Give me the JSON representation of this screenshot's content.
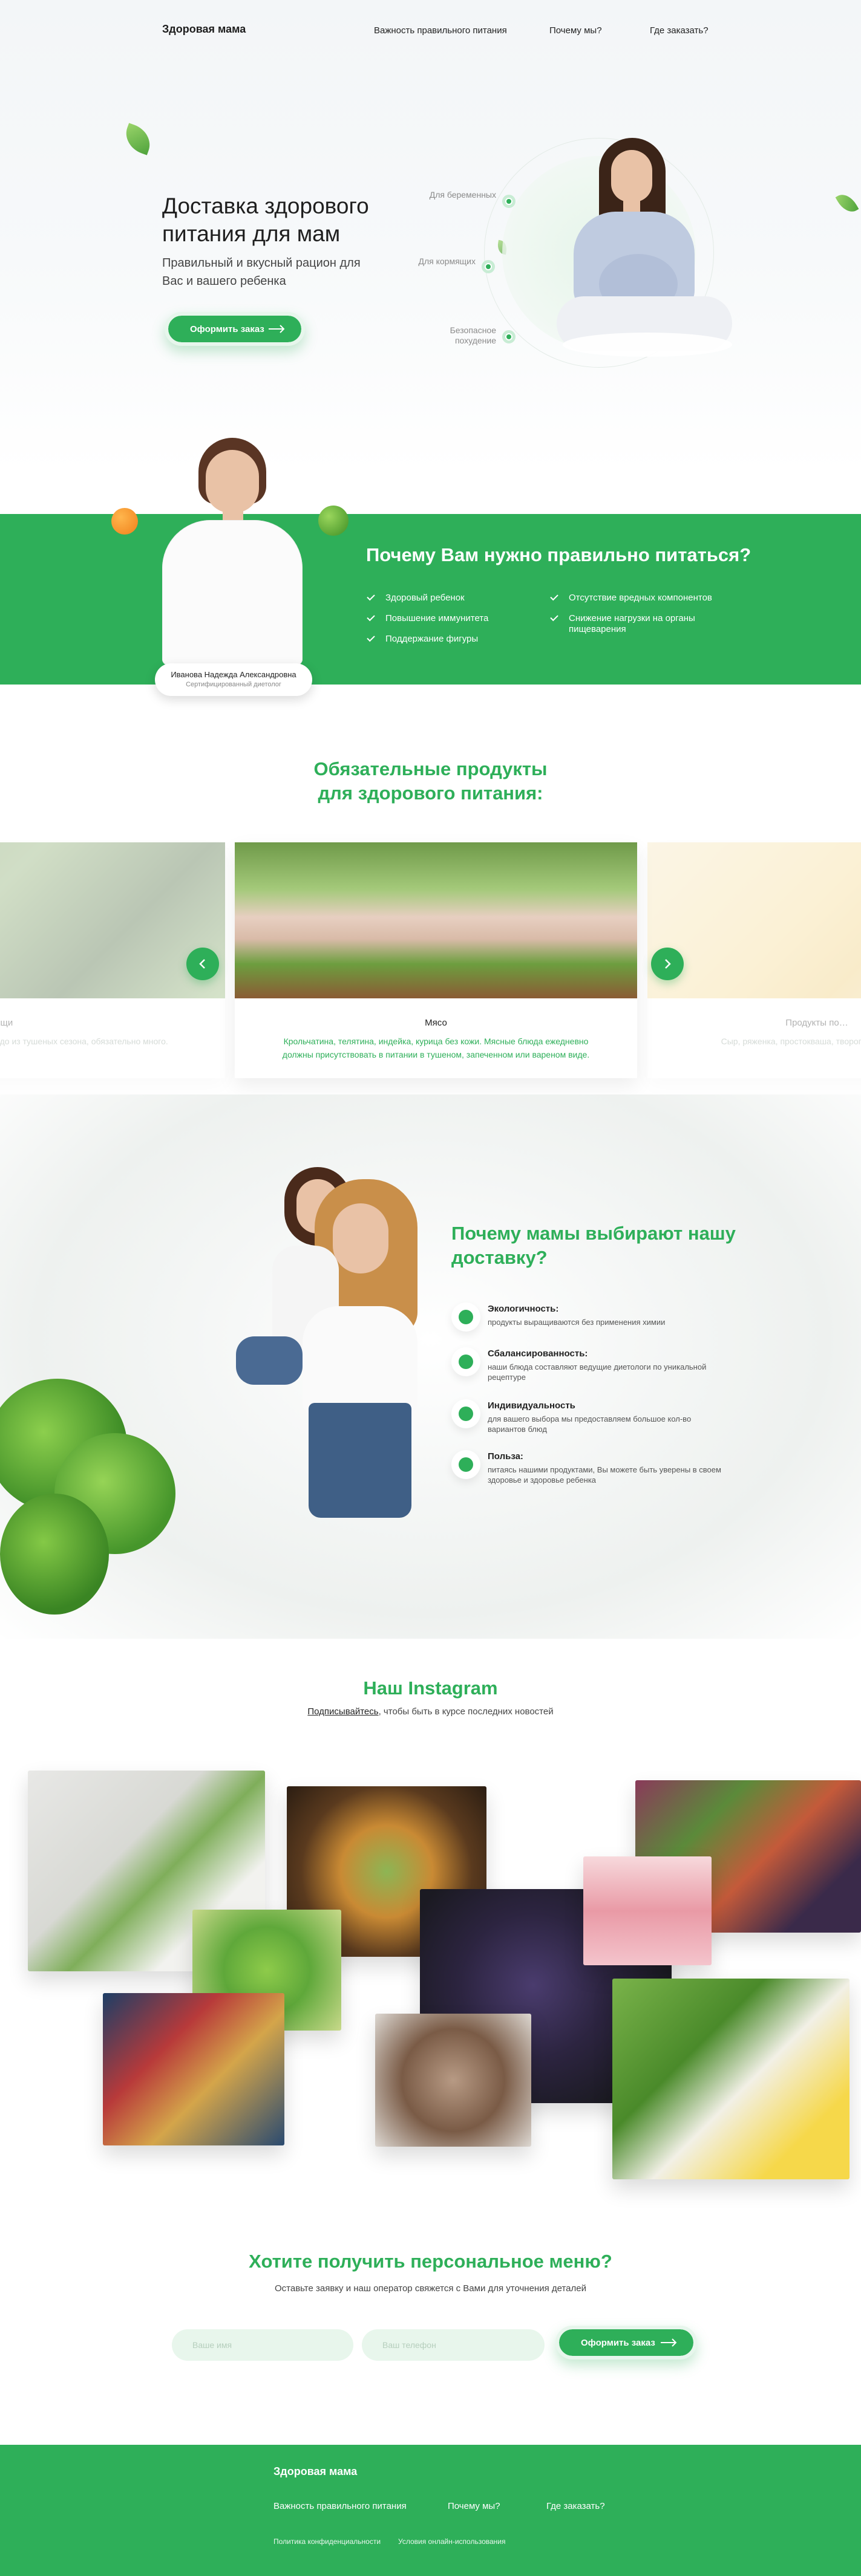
{
  "header": {
    "logo": "Здоровая мама",
    "nav": [
      "Важность правильного питания",
      "Почему мы?",
      "Где заказать?"
    ]
  },
  "hero": {
    "title": "Доставка здорового питания для мам",
    "subtitle": "Правильный и вкусный рацион для Вас и вашего ребенка",
    "button": "Оформить заказ",
    "bullets": [
      "Для беременных",
      "Для кормящих",
      "Безопасное похудение"
    ]
  },
  "why_eat": {
    "title": "Почему Вам нужно правильно питаться?",
    "col1": [
      "Здоровый ребенок",
      "Повышение иммунитета",
      "Поддержание фигуры"
    ],
    "col2": [
      "Отсутствие вредных компонентов",
      "Снижение нагрузки на органы пищеварения"
    ],
    "expert_name": "Иванова Надежда Александровна",
    "expert_role": "Сертифицированный диетолог"
  },
  "products": {
    "title": "Обязательные продукты для здорового питания:",
    "cards": [
      {
        "title": "Овощи",
        "text": "…гурцы, огурцы. Печеное блюдо из тушеных сезона, обязательно много."
      },
      {
        "title": "Мясо",
        "text": "Крольчатина, телятина, индейка, курица без кожи. Мясные блюда ежедневно должны присутствовать в питании в тушеном, запеченном или вареном виде."
      },
      {
        "title": "Продукты по…",
        "text": "Сыр, ряженка, простокваша, творог. Кисломолочные продукты…"
      }
    ]
  },
  "why_us": {
    "title": "Почему мамы выбирают нашу доставку?",
    "features": [
      {
        "title": "Экологичность:",
        "text": "продукты выращиваются без применения химии"
      },
      {
        "title": "Сбалансированность:",
        "text": "наши блюда составляют ведущие диетологи по уникальной рецептуре"
      },
      {
        "title": "Индивидуальность",
        "text": "для вашего выбора мы предоставляем большое кол-во вариантов блюд"
      },
      {
        "title": "Польза:",
        "text": "питаясь нашими продуктами, Вы можете быть уверены в своем здоровье и здоровье ребенка"
      }
    ]
  },
  "instagram": {
    "title": "Наш Instagram",
    "subscribe_link": "Подписывайтесь",
    "subscribe_text": ", чтобы быть в курсе последних новостей"
  },
  "form": {
    "title": "Хотите получить персональное меню?",
    "subtitle": "Оставьте заявку и наш оператор свяжется с Вами для уточнения деталей",
    "name_placeholder": "Ваше имя",
    "phone_placeholder": "Ваш телефон",
    "button": "Оформить заказ"
  },
  "footer": {
    "logo": "Здоровая мама",
    "nav": [
      "Важность правильного питания",
      "Почему мы?",
      "Где заказать?"
    ],
    "legal": [
      "Политика конфиденциальности",
      "Условия онлайн-использования"
    ]
  },
  "colors": {
    "accent": "#2eaf59",
    "accent_light": "#e8f6ec",
    "text": "#222222"
  }
}
